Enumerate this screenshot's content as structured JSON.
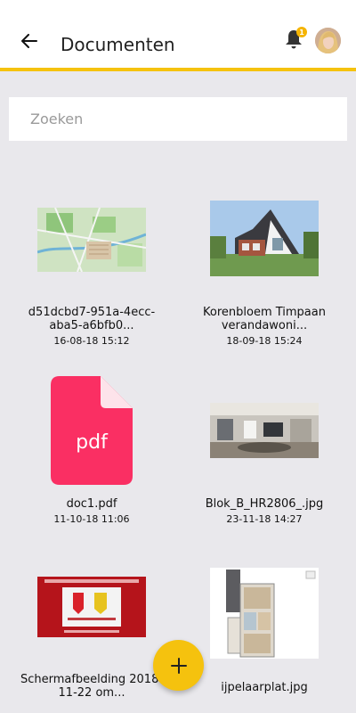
{
  "header": {
    "title": "Documenten",
    "notification_count": "1",
    "accent_color": "#f5c20e"
  },
  "search": {
    "placeholder": "Zoeken",
    "value": ""
  },
  "documents": [
    {
      "name": "d51dcbd7-951a-4ecc-\naba5-a6bfb0...",
      "date": "16-08-18 15:12",
      "thumbnail": "map-image"
    },
    {
      "name": "Korenbloem Timpaan\nverandawoni...",
      "date": "18-09-18 15:24",
      "thumbnail": "house-image"
    },
    {
      "name": "doc1.pdf",
      "date": "11-10-18 11:06",
      "thumbnail": "pdf-file-icon",
      "icon_label": "pdf",
      "icon_color": "#fa2f63"
    },
    {
      "name": "Blok_B_HR2806_.jpg",
      "date": "23-11-18 14:27",
      "thumbnail": "panorama-image"
    },
    {
      "name": "Schermafbeelding 2018-\n11-22 om...",
      "date": "",
      "thumbnail": "screenshot-image"
    },
    {
      "name": "ijpelaarplat.jpg",
      "date": "",
      "thumbnail": "floorplan-image"
    }
  ],
  "fab": {
    "label": "+"
  }
}
